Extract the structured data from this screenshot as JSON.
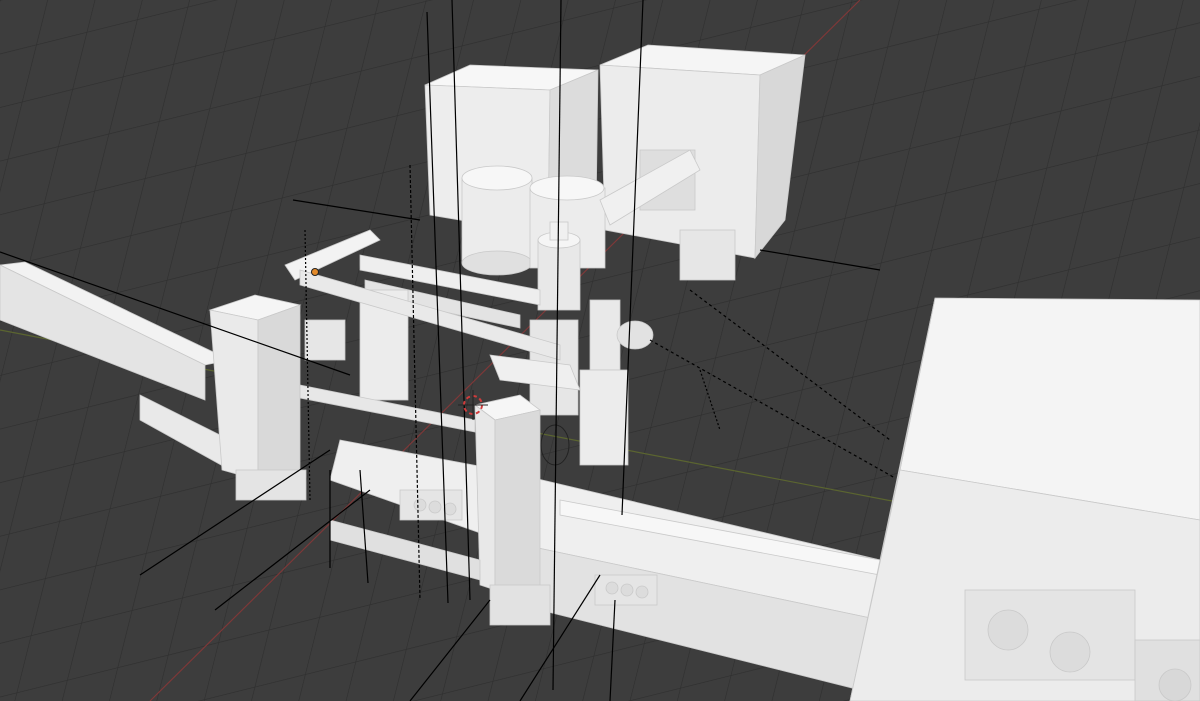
{
  "viewport": {
    "view": "3D Viewport",
    "shading": "solid",
    "background_color": "#3d3d3d",
    "grid_color": "#2e2e2e",
    "x_axis_color": "#8a3a3a",
    "y_axis_color": "#5f6b2f",
    "object_color": "#efefef",
    "object_shade_color": "#dcdcdc",
    "object_dark_shade_color": "#cdcdcd",
    "light_line_color": "#000000",
    "origin_point_color": "#e38a2a",
    "cursor_color": "#d23b3b"
  },
  "scene": {
    "objects": [
      "conveyor-rail-left",
      "conveyor-rail-right",
      "gantry-frame",
      "electrical-cabinet-left",
      "electrical-cabinet-right",
      "tank-left",
      "tank-right",
      "motor-housing",
      "pipe-assembly",
      "brush-assembly-left",
      "brush-assembly-right",
      "control-cabinet-foreground"
    ],
    "lights": [
      "light-rays"
    ],
    "cursor": "3d-cursor-icon",
    "origin": "object-origin-point"
  }
}
